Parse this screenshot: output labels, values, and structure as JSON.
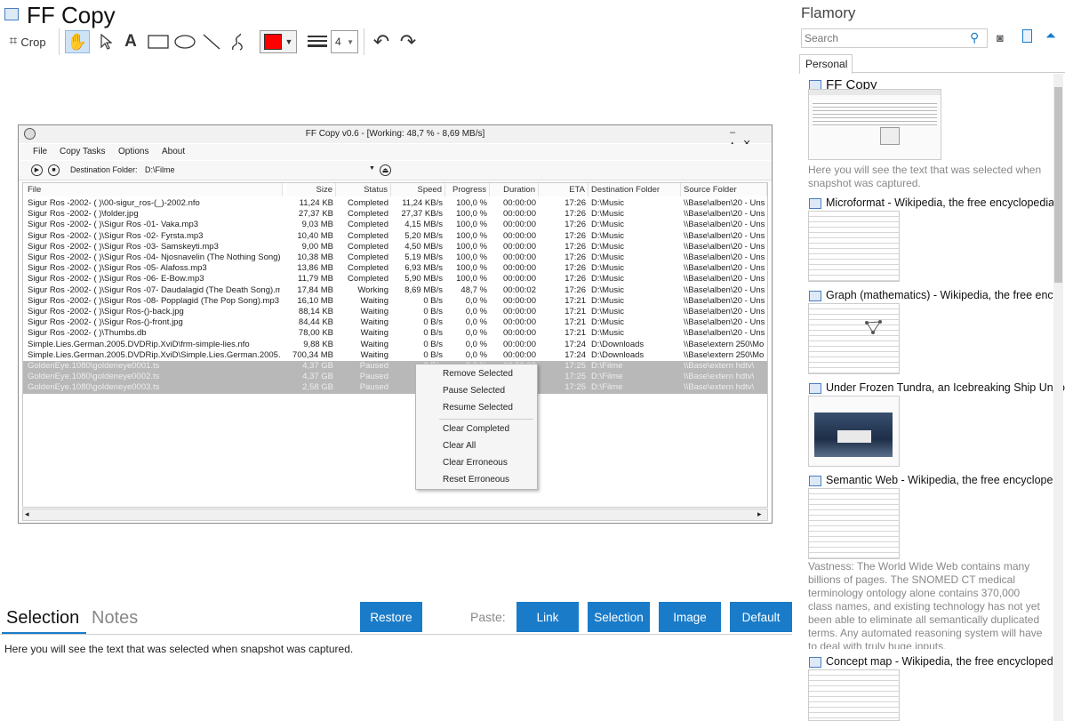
{
  "editor": {
    "title": "FF Copy",
    "toolbar": {
      "crop_label": "Crop",
      "line_width_value": "4",
      "color": "#ff0000"
    }
  },
  "screenshot": {
    "window_title": "FF Copy v0.6 - [Working: 48,7 % - 8,69 MB/s]",
    "menu": [
      "File",
      "Copy Tasks",
      "Options",
      "About"
    ],
    "dest_label": "Destination Folder:",
    "dest_value": "D:\\Filme",
    "columns": [
      "File",
      "Size",
      "Status",
      "Speed",
      "Progress",
      "Duration",
      "ETA",
      "Destination Folder",
      "Source Folder"
    ],
    "rows": [
      [
        "Sigur Ros -2002- ( )\\00-sigur_ros-(_)-2002.nfo",
        "11,24 KB",
        "Completed",
        "11,24 KB/s",
        "100,0 %",
        "00:00:00",
        "17:26",
        "D:\\Music",
        "\\\\Base\\alben\\20 - Uns"
      ],
      [
        "Sigur Ros -2002- ( )\\folder.jpg",
        "27,37 KB",
        "Completed",
        "27,37 KB/s",
        "100,0 %",
        "00:00:00",
        "17:26",
        "D:\\Music",
        "\\\\Base\\alben\\20 - Uns"
      ],
      [
        "Sigur Ros -2002- ( )\\Sigur Ros -01- Vaka.mp3",
        "9,03 MB",
        "Completed",
        "4,15 MB/s",
        "100,0 %",
        "00:00:00",
        "17:26",
        "D:\\Music",
        "\\\\Base\\alben\\20 - Uns"
      ],
      [
        "Sigur Ros -2002- ( )\\Sigur Ros -02- Fyrsta.mp3",
        "10,40 MB",
        "Completed",
        "5,20 MB/s",
        "100,0 %",
        "00:00:00",
        "17:26",
        "D:\\Music",
        "\\\\Base\\alben\\20 - Uns"
      ],
      [
        "Sigur Ros -2002- ( )\\Sigur Ros -03- Samskeyti.mp3",
        "9,00 MB",
        "Completed",
        "4,50 MB/s",
        "100,0 %",
        "00:00:00",
        "17:26",
        "D:\\Music",
        "\\\\Base\\alben\\20 - Uns"
      ],
      [
        "Sigur Ros -2002- ( )\\Sigur Ros -04- Njosnavelin (The Nothing Song)....",
        "10,38 MB",
        "Completed",
        "5,19 MB/s",
        "100,0 %",
        "00:00:00",
        "17:26",
        "D:\\Music",
        "\\\\Base\\alben\\20 - Uns"
      ],
      [
        "Sigur Ros -2002- ( )\\Sigur Ros -05- Alafoss.mp3",
        "13,86 MB",
        "Completed",
        "6,93 MB/s",
        "100,0 %",
        "00:00:00",
        "17:26",
        "D:\\Music",
        "\\\\Base\\alben\\20 - Uns"
      ],
      [
        "Sigur Ros -2002- ( )\\Sigur Ros -06- E-Bow.mp3",
        "11,79 MB",
        "Completed",
        "5,90 MB/s",
        "100,0 %",
        "00:00:00",
        "17:26",
        "D:\\Music",
        "\\\\Base\\alben\\20 - Uns"
      ],
      [
        "Sigur Ros -2002- ( )\\Sigur Ros -07- Daudalagid (The Death Song).m...",
        "17,84 MB",
        "Working",
        "8,69 MB/s",
        "48,7 %",
        "00:00:02",
        "17:26",
        "D:\\Music",
        "\\\\Base\\alben\\20 - Uns"
      ],
      [
        "Sigur Ros -2002- ( )\\Sigur Ros -08- Popplagid (The Pop Song).mp3",
        "16,10 MB",
        "Waiting",
        "0 B/s",
        "0,0 %",
        "00:00:00",
        "17:21",
        "D:\\Music",
        "\\\\Base\\alben\\20 - Uns"
      ],
      [
        "Sigur Ros -2002- ( )\\Sigur Ros-()-back.jpg",
        "88,14 KB",
        "Waiting",
        "0 B/s",
        "0,0 %",
        "00:00:00",
        "17:21",
        "D:\\Music",
        "\\\\Base\\alben\\20 - Uns"
      ],
      [
        "Sigur Ros -2002- ( )\\Sigur Ros-()-front.jpg",
        "84,44 KB",
        "Waiting",
        "0 B/s",
        "0,0 %",
        "00:00:00",
        "17:21",
        "D:\\Music",
        "\\\\Base\\alben\\20 - Uns"
      ],
      [
        "Sigur Ros -2002- ( )\\Thumbs.db",
        "78,00 KB",
        "Waiting",
        "0 B/s",
        "0,0 %",
        "00:00:00",
        "17:21",
        "D:\\Music",
        "\\\\Base\\alben\\20 - Uns"
      ],
      [
        "Simple.Lies.German.2005.DVDRip.XviD\\frm-simple-lies.nfo",
        "9,88 KB",
        "Waiting",
        "0 B/s",
        "0,0 %",
        "00:00:00",
        "17:24",
        "D:\\Downloads",
        "\\\\Base\\extern 250\\Mo"
      ],
      [
        "Simple.Lies.German.2005.DVDRip.XviD\\Simple.Lies.German.2005....",
        "700,34 MB",
        "Waiting",
        "0 B/s",
        "0,0 %",
        "00:00:00",
        "17:24",
        "D:\\Downloads",
        "\\\\Base\\extern 250\\Mo"
      ],
      [
        "GoldenEye.1080\\goldeneye0001.ts",
        "4,37 GB",
        "Paused",
        "0 B/s",
        "0,0 %",
        "00:00:00",
        "17:25",
        "D:\\Filme",
        "\\\\Base\\extern hdtv\\"
      ],
      [
        "GoldenEye.1080\\goldeneye0002.ts",
        "4,37 GB",
        "Paused",
        "0 B/s",
        "0,0 %",
        "00:00:00",
        "17:25",
        "D:\\Filme",
        "\\\\Base\\extern hdtv\\"
      ],
      [
        "GoldenEye.1080\\goldeneye0003.ts",
        "2,58 GB",
        "Paused",
        "0 B/s",
        "0,0 %",
        "00:00:00",
        "17:25",
        "D:\\Filme",
        "\\\\Base\\extern hdtv\\"
      ]
    ],
    "context_menu": [
      "Remove Selected",
      "Pause Selected",
      "Resume Selected",
      "Clear Completed",
      "Clear All",
      "Clear Erroneous",
      "Reset Erroneous"
    ]
  },
  "bottom": {
    "tabs": [
      "Selection",
      "Notes"
    ],
    "restore_label": "Restore",
    "paste_label": "Paste:",
    "paste_buttons": [
      "Link",
      "Selection",
      "Image",
      "Default"
    ],
    "selection_text": "Here you will see the text that was selected when snapshot was captured."
  },
  "flamory": {
    "title": "Flamory",
    "search_placeholder": "Search",
    "tab_personal": "Personal",
    "entries": [
      {
        "title": "FF Copy",
        "snippet": "Here you will see the text that was selected when snapshot was captured."
      },
      {
        "title": "Microformat - Wikipedia, the free encyclopedia",
        "snippet": ""
      },
      {
        "title": "Graph (mathematics) - Wikipedia, the free ency",
        "snippet": ""
      },
      {
        "title": "Under Frozen Tundra, an Icebreaking Ship Unco",
        "snippet": ""
      },
      {
        "title": "Semantic Web - Wikipedia, the free encycloped",
        "snippet": "Vastness: The World Wide Web contains many billions of pages. The SNOMED CT medical terminology ontology alone contains 370,000 class names, and existing technology has not yet been able to eliminate all semantically duplicated terms. Any automated reasoning system will have to deal with truly huge inputs."
      },
      {
        "title": "Concept map - Wikipedia, the free encyclopedi",
        "snippet": ""
      }
    ]
  },
  "colors": {
    "accent": "#1a7cc9",
    "selected_row": "#b8b8b8"
  }
}
